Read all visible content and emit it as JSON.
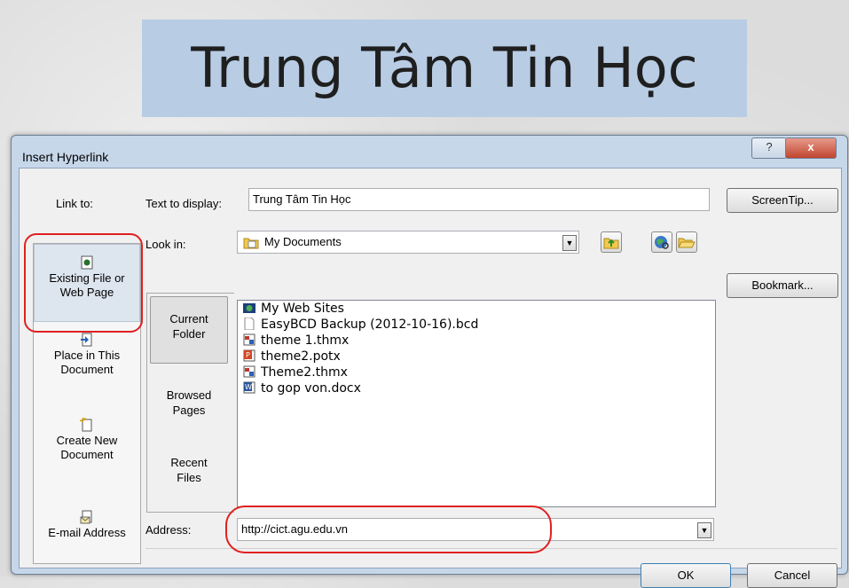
{
  "slide": {
    "title": "Trung Tâm Tin Học"
  },
  "dialog": {
    "title": "Insert Hyperlink",
    "help_label": "?",
    "close_label": "x",
    "link_to_label": "Link to:",
    "text_to_display_label": "Text to display:",
    "text_to_display_value": "Trung Tâm Tin Học",
    "screentip_label": "ScreenTip...",
    "look_in_label": "Look in:",
    "look_in_value": "My Documents",
    "bookmark_label": "Bookmark...",
    "address_label": "Address:",
    "address_value": "http://cict.agu.edu.vn",
    "ok_label": "OK",
    "cancel_label": "Cancel",
    "link_to_items": [
      {
        "line1": "Existing File or",
        "line2": "Web Page",
        "icon": "web-file-icon",
        "selected": true
      },
      {
        "line1": "Place in This",
        "line2": "Document",
        "icon": "place-in-doc-icon"
      },
      {
        "line1": "Create New",
        "line2": "Document",
        "icon": "new-document-icon"
      },
      {
        "line1": "E-mail Address",
        "line2": "",
        "icon": "email-icon"
      }
    ],
    "subpanel_items": [
      {
        "line1": "Current",
        "line2": "Folder",
        "selected": true
      },
      {
        "line1": "Browsed",
        "line2": "Pages"
      },
      {
        "line1": "Recent",
        "line2": "Files"
      }
    ],
    "files": [
      {
        "name": "My Web Sites",
        "icon": "web-folder-icon"
      },
      {
        "name": "EasyBCD Backup (2012-10-16).bcd",
        "icon": "blank-file-icon"
      },
      {
        "name": "theme 1.thmx",
        "icon": "theme-file-icon"
      },
      {
        "name": "theme2.potx",
        "icon": "powerpoint-file-icon"
      },
      {
        "name": "Theme2.thmx",
        "icon": "theme-file-icon"
      },
      {
        "name": "to gop von.docx",
        "icon": "word-file-icon"
      }
    ],
    "colors": {
      "title_bg": "#b8cce4",
      "highlight": "#e02020",
      "close_btn": "#c1452f"
    }
  }
}
